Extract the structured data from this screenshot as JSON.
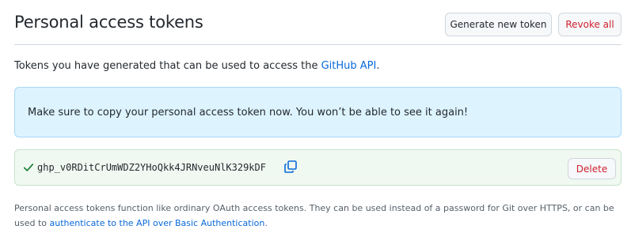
{
  "header": {
    "title": "Personal access tokens",
    "generate_label": "Generate new token",
    "revoke_all_label": "Revoke all"
  },
  "intro": {
    "text": "Tokens you have generated that can be used to access the ",
    "link_text": "GitHub API",
    "suffix": "."
  },
  "flash": {
    "message": "Make sure to copy your personal access token now. You won’t be able to see it again!"
  },
  "token": {
    "value": "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",
    "delete_label": "Delete",
    "status_icon": "check-icon",
    "copy_icon": "copy-icon"
  },
  "footnote": {
    "text": "Personal access tokens function like ordinary OAuth access tokens. They can be used instead of a password for Git over HTTPS, or can be used to ",
    "link_text": "authenticate to the API over Basic Authentication",
    "suffix": "."
  },
  "colors": {
    "link": "#0969da",
    "danger": "#cf222e",
    "flash_bg": "#ddf4ff",
    "token_bg": "#f0f9f1",
    "success": "#1a7f37"
  }
}
